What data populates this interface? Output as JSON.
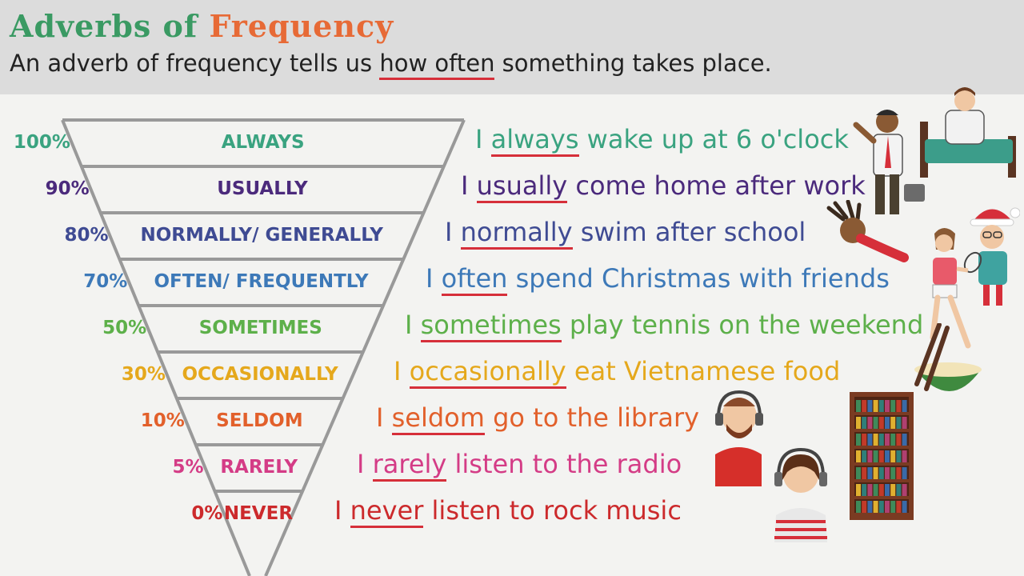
{
  "header": {
    "title_word1": "Adverbs of",
    "title_word2": "Frequency",
    "subtitle_before": "An adverb of frequency tells us ",
    "subtitle_highlight": "how often",
    "subtitle_after": " something takes place."
  },
  "levels": [
    {
      "percent": "100%",
      "adverb": "ALWAYS",
      "color": "#3aa380",
      "pre": "I ",
      "key": "always",
      "post": " wake up at 6 o'clock"
    },
    {
      "percent": "90%",
      "adverb": "USUALLY",
      "color": "#4b2a7c",
      "pre": "I ",
      "key": "usually",
      "post": " come home after work"
    },
    {
      "percent": "80%",
      "adverb": "NORMALLY/ GENERALLY",
      "color": "#3f4b93",
      "pre": "I ",
      "key": "normally",
      "post": " swim after school"
    },
    {
      "percent": "70%",
      "adverb": "OFTEN/ FREQUENTLY",
      "color": "#3d79b8",
      "pre": "I ",
      "key": "often",
      "post": " spend Christmas with friends"
    },
    {
      "percent": "50%",
      "adverb": "SOMETIMES",
      "color": "#5db04a",
      "pre": "I ",
      "key": "sometimes",
      "post": " play tennis on the weekend"
    },
    {
      "percent": "30%",
      "adverb": "OCCASIONALLY",
      "color": "#e5a81c",
      "pre": "I ",
      "key": "occasionally",
      "post": " eat Vietnamese food"
    },
    {
      "percent": "10%",
      "adverb": "SELDOM",
      "color": "#e2602b",
      "pre": "I ",
      "key": "seldom",
      "post": " go to the library"
    },
    {
      "percent": "5%",
      "adverb": "RARELY",
      "color": "#d43c86",
      "pre": "I ",
      "key": "rarely",
      "post": " listen to the radio"
    },
    {
      "percent": "0%",
      "adverb": "NEVER",
      "color": "#cc2a2c",
      "pre": "I ",
      "key": "never",
      "post": " listen to rock music"
    }
  ],
  "colors": {
    "funnel": "#999999",
    "underline": "#d62f3a",
    "header_bg": "#dcdcdc",
    "page_bg": "#f3f3f1"
  },
  "illustrations": [
    "waking-man-in-bed-icon",
    "businessman-with-briefcase-icon",
    "swimmer-icon",
    "girl-with-santa-hat-icon",
    "tennis-player-icon",
    "noodle-bowl-with-chopsticks-icon",
    "man-with-headphones-icon",
    "bookshelf-icon",
    "girl-with-headphones-icon"
  ]
}
